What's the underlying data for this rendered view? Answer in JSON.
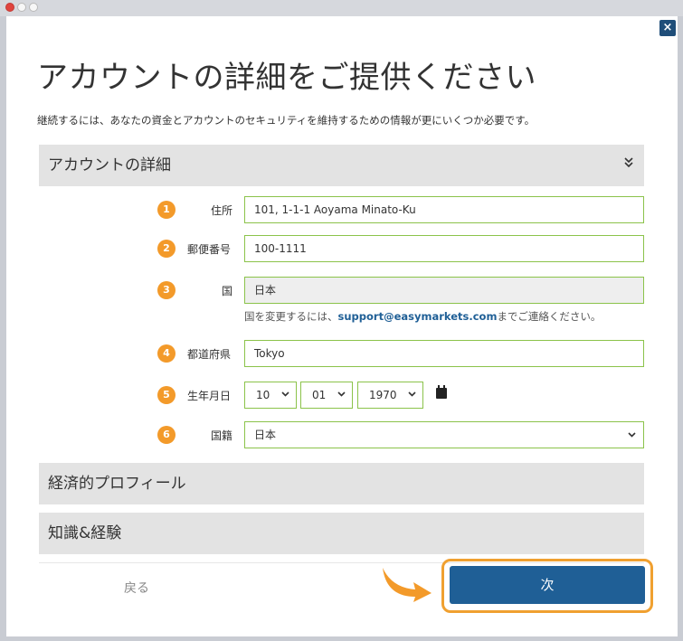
{
  "window": {
    "close_label": "×"
  },
  "header": {
    "title": "アカウントの詳細をご提供ください",
    "subtitle": "継続するには、あなたの資金とアカウントのセキュリティを維持するための情報が更にいくつか必要です。"
  },
  "sections": {
    "account": "アカウントの詳細",
    "economic": "経済的プロフィール",
    "knowledge": "知識&経験"
  },
  "form": {
    "address": {
      "badge": "1",
      "label": "住所",
      "value": "101, 1-1-1 Aoyama Minato-Ku"
    },
    "postal": {
      "badge": "2",
      "label": "郵便番号",
      "value": "100-1111"
    },
    "country": {
      "badge": "3",
      "label": "国",
      "value": "日本"
    },
    "hint_before": "国を変更するには、",
    "hint_email": "support@easymarkets.com",
    "hint_after": "までご連絡ください。",
    "prefecture": {
      "badge": "4",
      "label": "都道府県",
      "value": "Tokyo"
    },
    "birthdate": {
      "badge": "5",
      "label": "生年月日",
      "month": "10",
      "day": "01",
      "year": "1970"
    },
    "nationality": {
      "badge": "6",
      "label": "国籍",
      "value": "日本"
    }
  },
  "footer": {
    "back_label": "戻る",
    "next_label": "次"
  },
  "colors": {
    "accent": "#1f5f96",
    "badge": "#f39a2a",
    "field_border": "#8bc34a",
    "highlight": "#f0a030"
  },
  "icons": {
    "chevron": "chevron-double-down-icon",
    "calendar": "calendar-icon",
    "close": "close-icon"
  }
}
